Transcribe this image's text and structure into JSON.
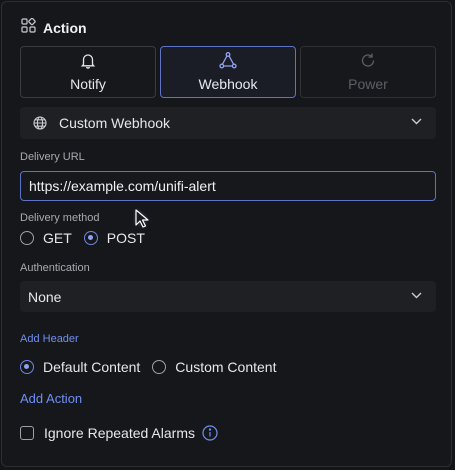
{
  "section": {
    "title": "Action",
    "icon": "widgets-icon"
  },
  "tabs": [
    {
      "label": "Notify",
      "icon": "bell-icon",
      "state": "normal"
    },
    {
      "label": "Webhook",
      "icon": "webhook-icon",
      "state": "active"
    },
    {
      "label": "Power",
      "icon": "refresh-icon",
      "state": "disabled"
    }
  ],
  "webhook_type": {
    "value": "Custom Webhook",
    "icon": "globe-icon"
  },
  "delivery_url": {
    "label": "Delivery URL",
    "value": "https://example.com/unifi-alert"
  },
  "delivery_method": {
    "label": "Delivery method",
    "options": [
      {
        "label": "GET",
        "selected": false
      },
      {
        "label": "POST",
        "selected": true
      }
    ]
  },
  "authentication": {
    "label": "Authentication",
    "value": "None"
  },
  "add_header_label": "Add Header",
  "content": {
    "options": [
      {
        "label": "Default Content",
        "selected": true
      },
      {
        "label": "Custom Content",
        "selected": false
      }
    ]
  },
  "add_action_label": "Add Action",
  "ignore_repeated": {
    "label": "Ignore Repeated Alarms",
    "checked": false
  },
  "colors": {
    "accent": "#5c73c7",
    "link": "#6f8ff0",
    "background": "#16171a"
  }
}
